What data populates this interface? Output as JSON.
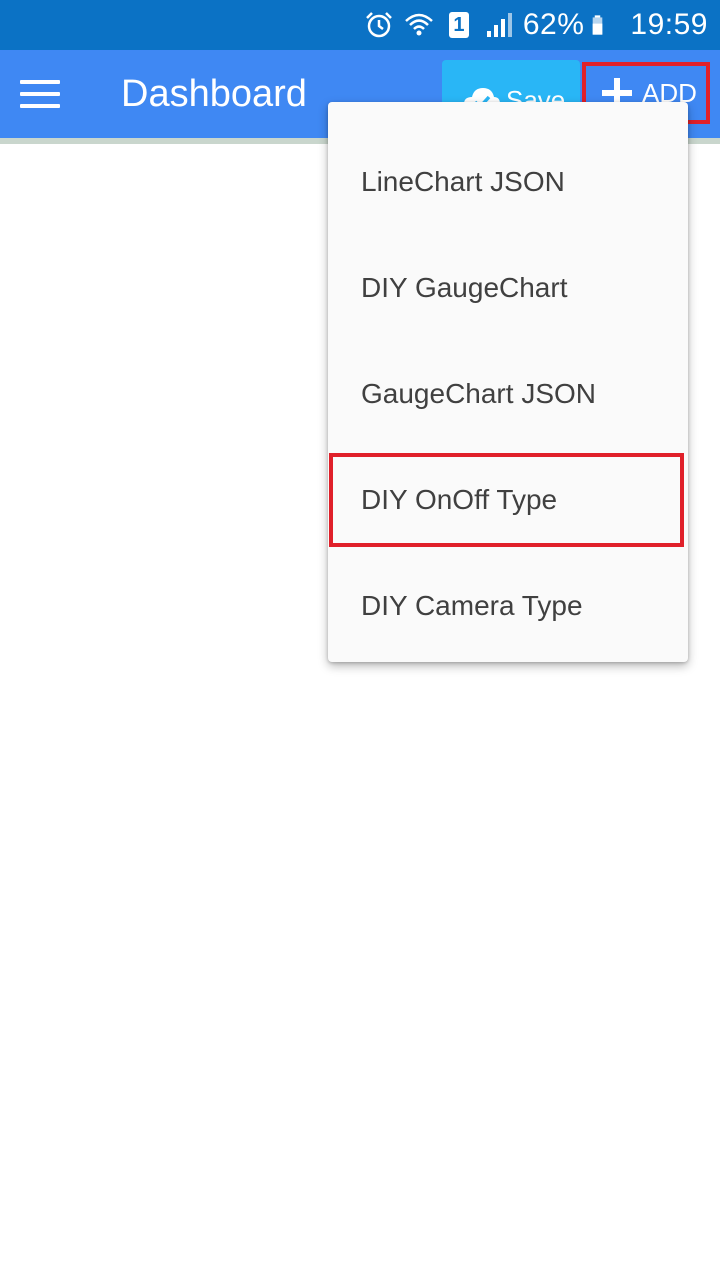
{
  "status_bar": {
    "battery_percent": "62%",
    "time": "19:59",
    "sim_label": "1",
    "icons": [
      "alarm-icon",
      "wifi-icon",
      "sim-icon",
      "signal-icon",
      "battery-icon"
    ]
  },
  "app_bar": {
    "title": "Dashboard",
    "save_label": "Save",
    "add_label": "ADD",
    "color": "#3f88f3"
  },
  "dropdown": {
    "items": [
      {
        "label": "LineChart JSON"
      },
      {
        "label": "DIY GaugeChart"
      },
      {
        "label": "GaugeChart JSON"
      },
      {
        "label": "DIY OnOff Type"
      },
      {
        "label": "DIY Camera Type"
      }
    ]
  },
  "colors": {
    "status_bar": "#0b72c5",
    "save_button": "#29b6f6",
    "highlight": "#e0202a"
  }
}
